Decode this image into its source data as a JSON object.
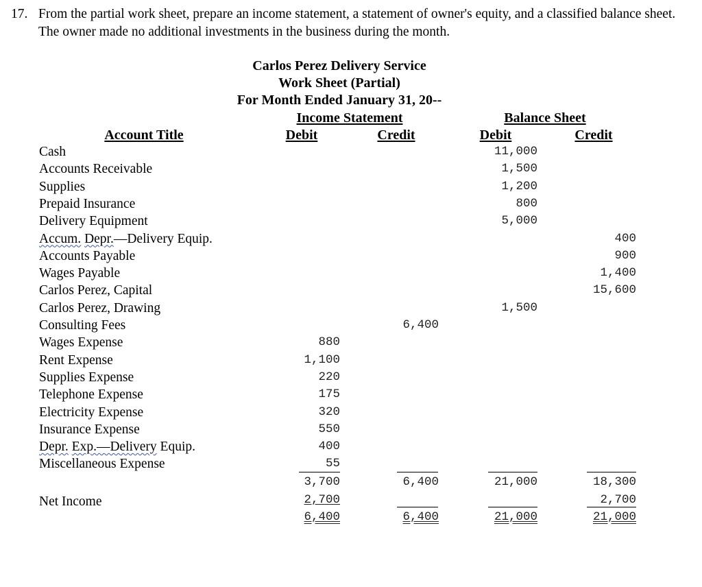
{
  "problem": {
    "number": "17.",
    "text": "From the partial work sheet, prepare an income statement, a statement of owner's equity, and a classified balance sheet. The owner made no additional investments in the business during the month."
  },
  "heading": {
    "company": "Carlos Perez Delivery Service",
    "title": "Work Sheet (Partial)",
    "period": "For Month Ended January 31, 20--"
  },
  "columns": {
    "account_title": "Account Title",
    "income_statement": "Income Statement",
    "balance_sheet": "Balance Sheet",
    "is_debit": "Debit",
    "is_credit": "Credit",
    "bs_debit": "Debit",
    "bs_credit": "Credit"
  },
  "accounts": [
    {
      "title": "Cash",
      "is_debit": "",
      "is_credit": "",
      "bs_debit": "11,000",
      "bs_credit": ""
    },
    {
      "title": "Accounts Receivable",
      "is_debit": "",
      "is_credit": "",
      "bs_debit": "1,500",
      "bs_credit": ""
    },
    {
      "title": "Supplies",
      "is_debit": "",
      "is_credit": "",
      "bs_debit": "1,200",
      "bs_credit": ""
    },
    {
      "title": "Prepaid Insurance",
      "is_debit": "",
      "is_credit": "",
      "bs_debit": "800",
      "bs_credit": ""
    },
    {
      "title": "Delivery Equipment",
      "is_debit": "",
      "is_credit": "",
      "bs_debit": "5,000",
      "bs_credit": ""
    },
    {
      "title_a": "Accum.",
      "title_b": "Depr.",
      "title_c": "—Delivery Equip.",
      "is_debit": "",
      "is_credit": "",
      "bs_debit": "",
      "bs_credit": "400"
    },
    {
      "title": "Accounts Payable",
      "is_debit": "",
      "is_credit": "",
      "bs_debit": "",
      "bs_credit": "900"
    },
    {
      "title": "Wages Payable",
      "is_debit": "",
      "is_credit": "",
      "bs_debit": "",
      "bs_credit": "1,400"
    },
    {
      "title": "Carlos Perez, Capital",
      "is_debit": "",
      "is_credit": "",
      "bs_debit": "",
      "bs_credit": "15,600"
    },
    {
      "title": "Carlos Perez, Drawing",
      "is_debit": "",
      "is_credit": "",
      "bs_debit": "1,500",
      "bs_credit": ""
    },
    {
      "title": "Consulting Fees",
      "is_debit": "",
      "is_credit": "6,400",
      "bs_debit": "",
      "bs_credit": ""
    },
    {
      "title": "Wages Expense",
      "is_debit": "880",
      "is_credit": "",
      "bs_debit": "",
      "bs_credit": ""
    },
    {
      "title": "Rent Expense",
      "is_debit": "1,100",
      "is_credit": "",
      "bs_debit": "",
      "bs_credit": ""
    },
    {
      "title": "Supplies Expense",
      "is_debit": "220",
      "is_credit": "",
      "bs_debit": "",
      "bs_credit": ""
    },
    {
      "title": "Telephone Expense",
      "is_debit": "175",
      "is_credit": "",
      "bs_debit": "",
      "bs_credit": ""
    },
    {
      "title": "Electricity Expense",
      "is_debit": "320",
      "is_credit": "",
      "bs_debit": "",
      "bs_credit": ""
    },
    {
      "title": "Insurance Expense",
      "is_debit": "550",
      "is_credit": "",
      "bs_debit": "",
      "bs_credit": ""
    },
    {
      "title_a": "Depr.",
      "title_b": "Exp.—Delivery",
      "title_c": " Equip.",
      "is_debit": "400",
      "is_credit": "",
      "bs_debit": "",
      "bs_credit": ""
    },
    {
      "title": "Miscellaneous Expense",
      "is_debit": "55",
      "is_credit": "",
      "bs_debit": "",
      "bs_credit": ""
    }
  ],
  "subtotals": {
    "is_debit": "3,700",
    "is_credit": "6,400",
    "bs_debit": "21,000",
    "bs_credit": "18,300"
  },
  "net_income": {
    "label": "Net Income",
    "is_debit": "2,700",
    "bs_credit": "2,700"
  },
  "totals": {
    "is_debit": "6,400",
    "is_credit": "6,400",
    "bs_debit": "21,000",
    "bs_credit": "21,000"
  }
}
